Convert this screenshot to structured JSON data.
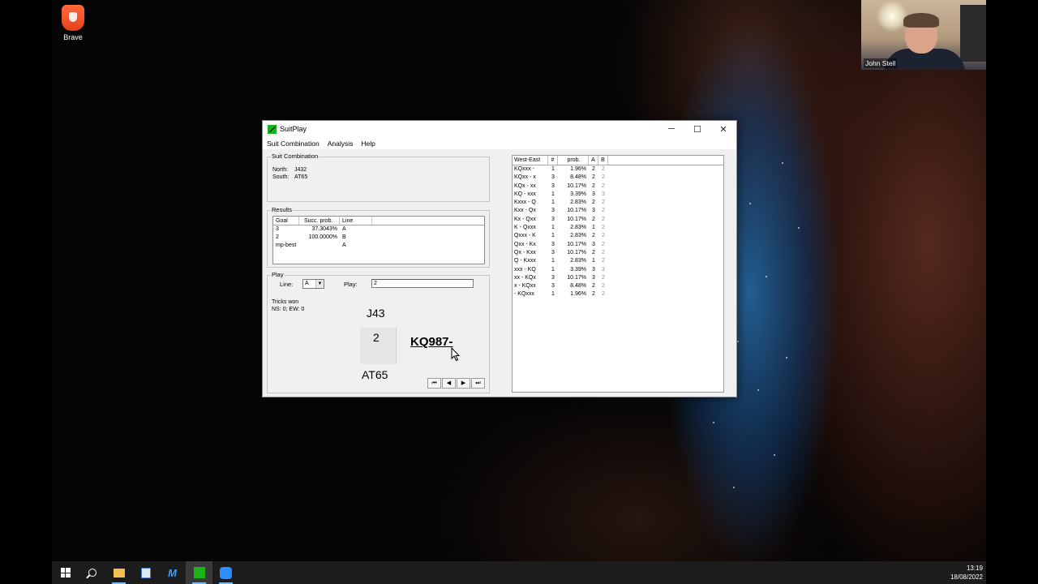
{
  "desktop": {
    "icon_label": "Brave"
  },
  "webcam": {
    "participant_name": "John Stell"
  },
  "window": {
    "title": "SuitPlay",
    "controls": {
      "minimize": "─",
      "maximize": "☐",
      "close": "✕"
    },
    "menu": [
      "Suit Combination",
      "Analysis",
      "Help"
    ]
  },
  "suit_combination": {
    "group_title": "Suit Combination",
    "north_label": "North:",
    "north_value": "J432",
    "south_label": "South:",
    "south_value": "AT65"
  },
  "results": {
    "group_title": "Results",
    "headers": [
      "Goal",
      "Succ. prob.",
      "Line"
    ],
    "rows": [
      {
        "goal": "3",
        "succ": "37.3043%",
        "line": "A"
      },
      {
        "goal": "2",
        "succ": "100.0000%",
        "line": "B"
      },
      {
        "goal": "mp-best",
        "succ": "",
        "line": "A"
      }
    ]
  },
  "play": {
    "group_title": "Play",
    "line_label": "Line:",
    "line_value": "A",
    "play_label": "Play:",
    "play_value": "2",
    "tricks_label": "Tricks won",
    "tricks_value": "NS: 0; EW: 0",
    "north_hand": "J43",
    "card_played": "2",
    "east_hand": "KQ987-",
    "south_hand": "AT65",
    "nav": [
      "⏮",
      "◀",
      "▶",
      "⏭"
    ]
  },
  "distribution": {
    "headers": [
      "West-East",
      "#",
      "prob.",
      "A",
      "B"
    ],
    "rows": [
      {
        "we": "KQxxx -",
        "n": "1",
        "p": "1.96%",
        "a": "2",
        "b": "2"
      },
      {
        "we": "KQxx - x",
        "n": "3",
        "p": "8.48%",
        "a": "2",
        "b": "2"
      },
      {
        "we": "KQx - xx",
        "n": "3",
        "p": "10.17%",
        "a": "2",
        "b": "2"
      },
      {
        "we": "KQ - xxx",
        "n": "1",
        "p": "3.39%",
        "a": "3",
        "b": "3"
      },
      {
        "we": "Kxxx - Q",
        "n": "1",
        "p": "2.83%",
        "a": "2",
        "b": "2"
      },
      {
        "we": "Kxx - Qx",
        "n": "3",
        "p": "10.17%",
        "a": "3",
        "b": "2"
      },
      {
        "we": "Kx - Qxx",
        "n": "3",
        "p": "10.17%",
        "a": "2",
        "b": "2"
      },
      {
        "we": "K - Qxxx",
        "n": "1",
        "p": "2.83%",
        "a": "1",
        "b": "2"
      },
      {
        "we": "Qxxx - K",
        "n": "1",
        "p": "2.83%",
        "a": "2",
        "b": "2"
      },
      {
        "we": "Qxx - Kx",
        "n": "3",
        "p": "10.17%",
        "a": "3",
        "b": "2"
      },
      {
        "we": "Qx - Kxx",
        "n": "3",
        "p": "10.17%",
        "a": "2",
        "b": "2"
      },
      {
        "we": "Q - Kxxx",
        "n": "1",
        "p": "2.83%",
        "a": "1",
        "b": "2"
      },
      {
        "we": "xxx - KQ",
        "n": "1",
        "p": "3.39%",
        "a": "3",
        "b": "3"
      },
      {
        "we": "xx - KQx",
        "n": "3",
        "p": "10.17%",
        "a": "3",
        "b": "2"
      },
      {
        "we": "x - KQxx",
        "n": "3",
        "p": "8.48%",
        "a": "2",
        "b": "2"
      },
      {
        "we": " - KQxxx",
        "n": "1",
        "p": "1.96%",
        "a": "2",
        "b": "2"
      }
    ]
  },
  "taskbar": {
    "time": "13:19",
    "date": "18/08/2022"
  }
}
